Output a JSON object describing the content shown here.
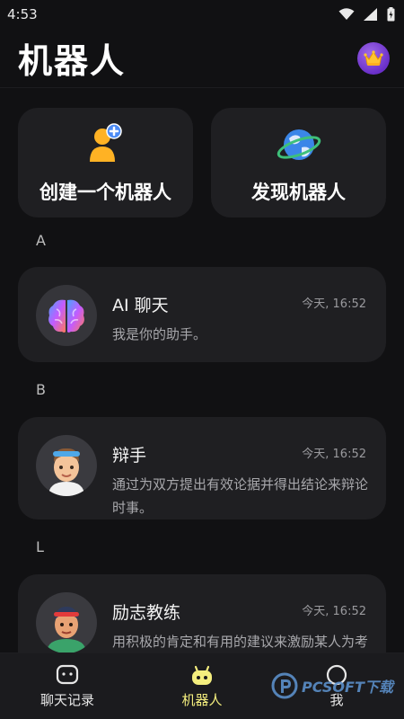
{
  "status_bar": {
    "time": "4:53"
  },
  "header": {
    "title": "机器人"
  },
  "actions": [
    {
      "label": "创建一个机器人"
    },
    {
      "label": "发现机器人"
    }
  ],
  "sections": [
    {
      "letter": "A",
      "bots": [
        {
          "name": "AI 聊天",
          "time": "今天, 16:52",
          "desc": "我是你的助手。"
        }
      ]
    },
    {
      "letter": "B",
      "bots": [
        {
          "name": "辩手",
          "time": "今天, 16:52",
          "desc": "通过为双方提出有效论据并得出结论来辩论时事。"
        }
      ]
    },
    {
      "letter": "L",
      "bots": [
        {
          "name": "励志教练",
          "time": "今天, 16:52",
          "desc": "用积极的肯定和有用的建议来激励某人为考试而学习"
        }
      ]
    }
  ],
  "tabs": [
    {
      "label": "聊天记录",
      "active": false
    },
    {
      "label": "机器人",
      "active": true
    },
    {
      "label": "我",
      "active": false
    }
  ],
  "colors": {
    "accent": "#f4ee7e",
    "card": "#1f1f22",
    "background": "#111113"
  },
  "watermark": {
    "text": "PCSOFT下载"
  }
}
